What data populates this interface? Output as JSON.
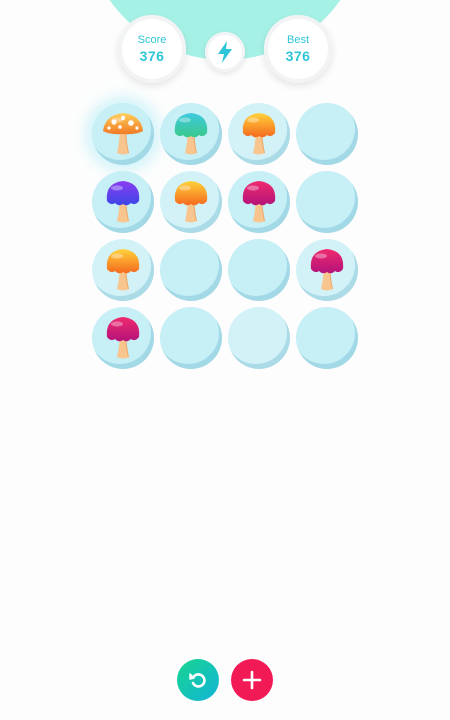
{
  "header": {
    "score_label": "Score",
    "score_value": "376",
    "best_label": "Best",
    "best_value": "376",
    "center_icon": "lightning-bolt-icon"
  },
  "board": {
    "rows": 4,
    "cols": 4,
    "cells": [
      [
        "spotted-orange",
        "teal-green",
        "orange",
        "empty"
      ],
      [
        "purple",
        "orange",
        "magenta",
        "empty"
      ],
      [
        "orange",
        "empty",
        "empty",
        "magenta"
      ],
      [
        "magenta",
        "empty",
        "empty",
        "empty"
      ]
    ]
  },
  "mushroom_colors": {
    "spotted-orange": [
      "#ffcf5a",
      "#f07a26"
    ],
    "teal-green": [
      "#3ec9e0",
      "#3ac98a"
    ],
    "orange": [
      "#ffd23a",
      "#f56a1f"
    ],
    "purple": [
      "#8b3cf0",
      "#3b47e8"
    ],
    "magenta": [
      "#f02a6e",
      "#b3137a"
    ]
  },
  "controls": {
    "undo_icon": "undo-icon",
    "add_icon": "plus-icon"
  },
  "colors": {
    "accent_text": "#2ec5d8",
    "header_arc": "#a6f1e6",
    "cell": "#c6eff6",
    "undo_button": "#14c6b4",
    "add_button": "#f21a55"
  }
}
